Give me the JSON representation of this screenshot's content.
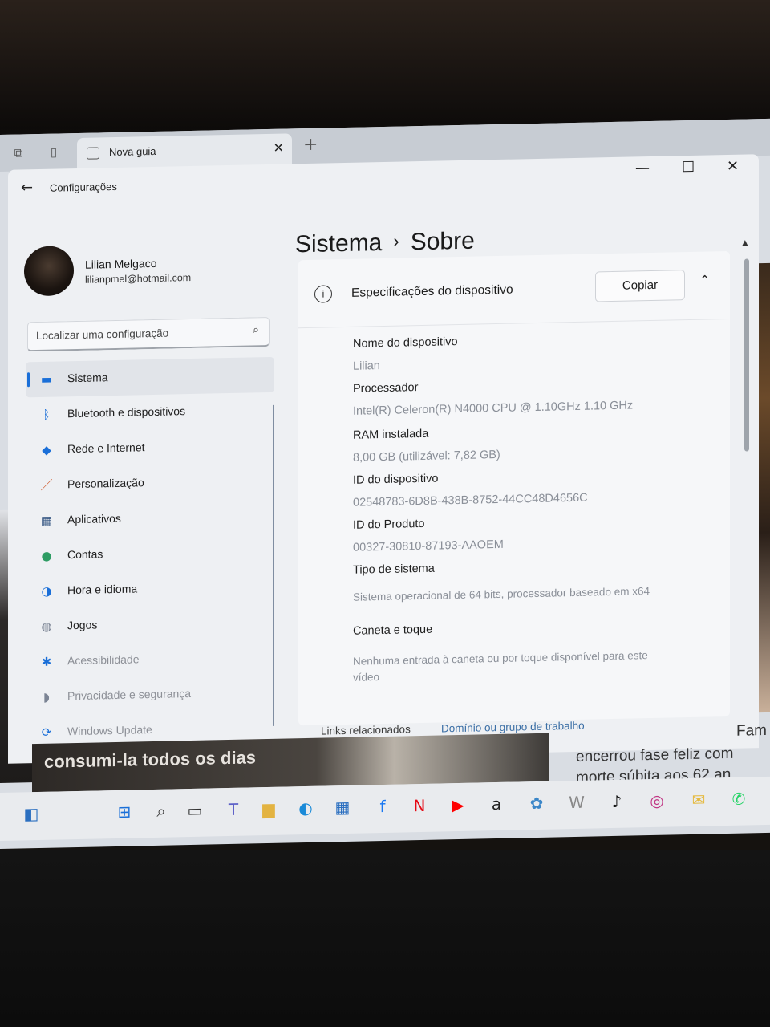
{
  "browser": {
    "tab_title": "Nova guia",
    "tab_close": "✕",
    "new_tab": "+"
  },
  "window": {
    "app_title": "Configurações",
    "back_icon": "arrow-left-icon",
    "minimize": "—",
    "maximize": "☐",
    "close": "✕"
  },
  "user": {
    "name": "Lilian Melgaco",
    "email": "lilianpmel@hotmail.com"
  },
  "search": {
    "placeholder": "Localizar uma configuração"
  },
  "nav": [
    {
      "label": "Sistema",
      "icon": "monitor-icon",
      "color": "#1a6fd8"
    },
    {
      "label": "Bluetooth e dispositivos",
      "icon": "bluetooth-icon",
      "color": "#1a6fd8"
    },
    {
      "label": "Rede e Internet",
      "icon": "wifi-icon",
      "color": "#1a6fd8"
    },
    {
      "label": "Personalização",
      "icon": "brush-icon",
      "color": "#d0582a"
    },
    {
      "label": "Aplicativos",
      "icon": "apps-icon",
      "color": "#3b5b86"
    },
    {
      "label": "Contas",
      "icon": "person-icon",
      "color": "#2d9c63"
    },
    {
      "label": "Hora e idioma",
      "icon": "globe-clock-icon",
      "color": "#1a6fd8"
    },
    {
      "label": "Jogos",
      "icon": "gamepad-icon",
      "color": "#7b8494"
    },
    {
      "label": "Acessibilidade",
      "icon": "accessibility-icon",
      "color": "#1a6fd8"
    },
    {
      "label": "Privacidade e segurança",
      "icon": "shield-icon",
      "color": "#7b8494"
    },
    {
      "label": "Windows Update",
      "icon": "update-icon",
      "color": "#1a6fd8"
    }
  ],
  "breadcrumb": {
    "parent": "Sistema",
    "separator": "›",
    "current": "Sobre"
  },
  "device_specs": {
    "title": "Especificações do dispositivo",
    "copy_button": "Copiar",
    "items": [
      {
        "label": "Nome do dispositivo",
        "value": "Lilian"
      },
      {
        "label": "Processador",
        "value": "Intel(R) Celeron(R) N4000 CPU @ 1.10GHz   1.10 GHz"
      },
      {
        "label": "RAM instalada",
        "value": "8,00 GB (utilizável: 7,82 GB)"
      },
      {
        "label": "ID do dispositivo",
        "value": "02548783-6D8B-438B-8752-44CC48D4656C"
      },
      {
        "label": "ID do Produto",
        "value": "00327-30810-87193-AAOEM"
      },
      {
        "label": "Tipo de sistema",
        "value": "Sistema operacional de 64 bits, processador baseado em x64"
      },
      {
        "label": "Caneta e toque",
        "value": "Nenhuma entrada à caneta ou por toque disponível para este vídeo"
      }
    ]
  },
  "related": {
    "label": "Links relacionados",
    "link": "Domínio ou grupo de trabalho"
  },
  "background_page": {
    "headline_left": "consumi-la todos os dias",
    "headline_right_1": "encerrou fase feliz com",
    "headline_right_2": "morte súbita aos 62 an",
    "fam": "Fam"
  },
  "taskbar": {
    "icons": [
      "widgets-icon",
      "start-icon",
      "search-icon",
      "task-view-icon",
      "teams-icon",
      "file-explorer-icon",
      "edge-icon",
      "store-icon",
      "facebook-icon",
      "netflix-icon",
      "youtube-icon",
      "amazon-icon",
      "photos-icon",
      "wikipedia-icon",
      "tiktok-icon",
      "instagram-icon",
      "mail-icon",
      "whatsapp-icon"
    ],
    "glyphs": [
      "◧",
      "⊞",
      "⌕",
      "▭",
      "T",
      "▆",
      "◐",
      "▦",
      "f",
      "N",
      "▶",
      "a",
      "✿",
      "W",
      "♪",
      "◎",
      "✉",
      "✆"
    ]
  }
}
